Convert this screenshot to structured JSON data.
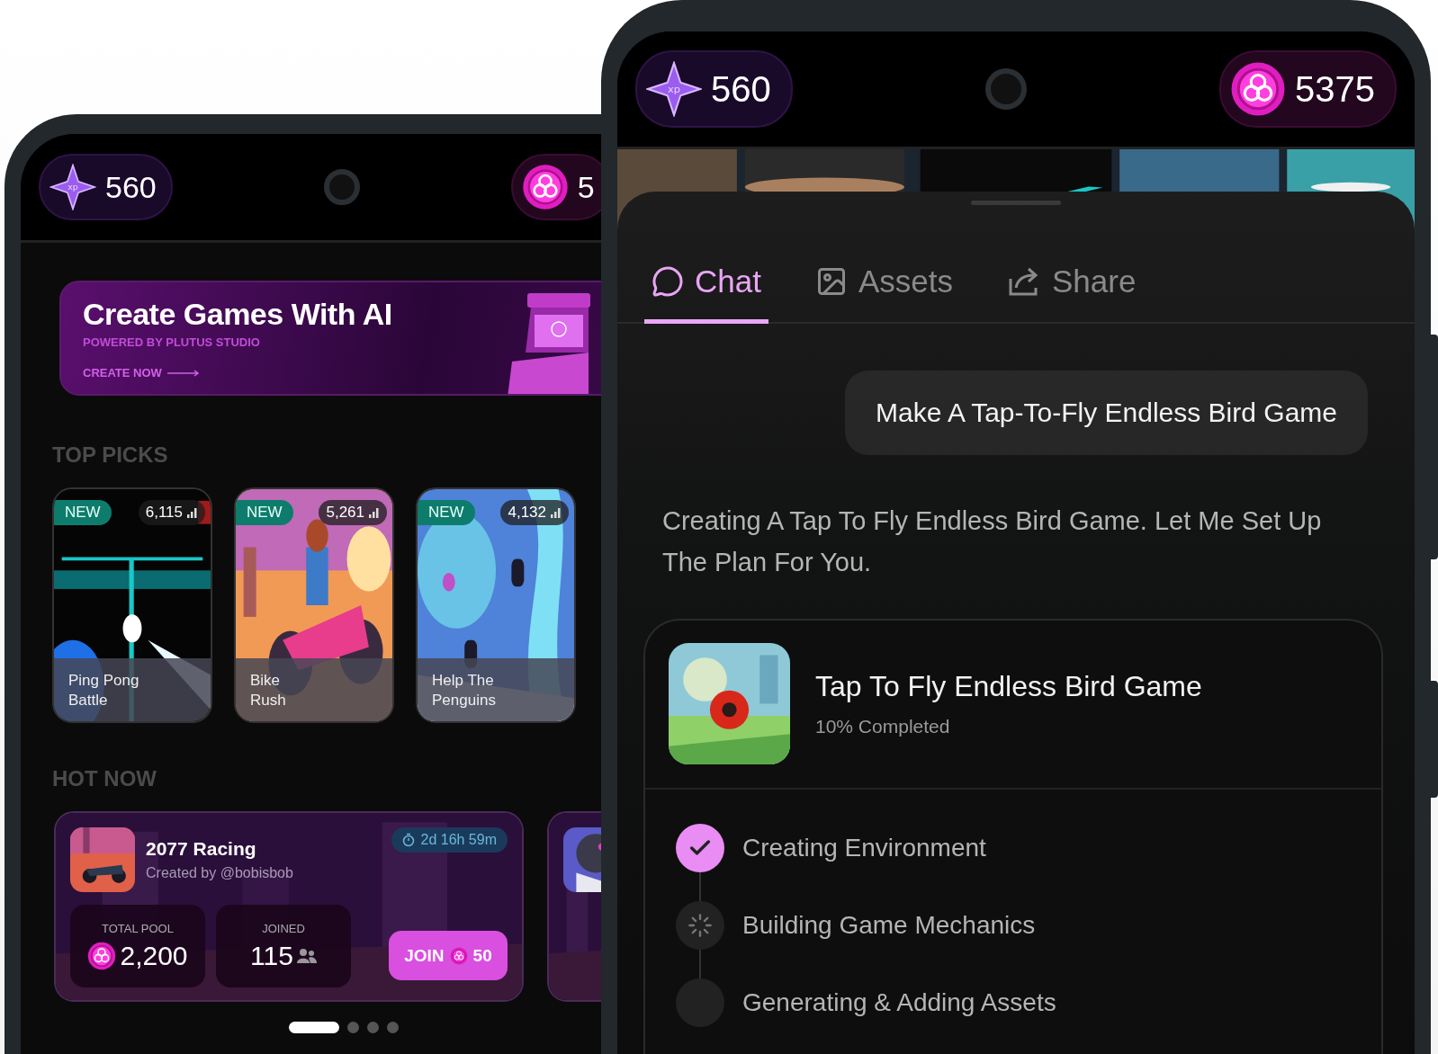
{
  "left_phone": {
    "xp": {
      "icon_label": "xp",
      "value": "560"
    },
    "coins": {
      "value": "5"
    },
    "banner": {
      "title": "Create Games With AI",
      "subtitle": "POWERED BY PLUTUS STUDIO",
      "cta": "CREATE NOW"
    },
    "top_picks": {
      "heading": "TOP PICKS",
      "games": [
        {
          "badge": "NEW",
          "plays": "6,115",
          "title_lines": [
            "Ping Pong",
            "Battle"
          ]
        },
        {
          "badge": "NEW",
          "plays": "5,261",
          "title_lines": [
            "Bike",
            "Rush"
          ]
        },
        {
          "badge": "NEW",
          "plays": "4,132",
          "title_lines": [
            "Help The",
            "Penguins"
          ]
        }
      ]
    },
    "hot_now": {
      "heading": "HOT NOW",
      "card": {
        "title": "2077 Racing",
        "creator": "Created by @bobisbob",
        "timer": "2d 16h 59m",
        "pool_label": "TOTAL POOL",
        "pool": "2,200",
        "joined_label": "JOINED",
        "joined": "115",
        "join_label": "JOIN",
        "join_cost": "50"
      },
      "pager": [
        {
          "selected": true
        },
        {
          "selected": false
        },
        {
          "selected": false
        },
        {
          "selected": false
        }
      ]
    }
  },
  "right_phone": {
    "xp": {
      "icon_label": "xp",
      "value": "560"
    },
    "coins": {
      "value": "5375"
    },
    "tabs": [
      {
        "kind": "chat",
        "label": "Chat",
        "selected": true
      },
      {
        "kind": "assets",
        "label": "Assets",
        "selected": false
      },
      {
        "kind": "share",
        "label": "Share",
        "selected": false
      }
    ],
    "prompt": "Make A Tap-To-Fly Endless Bird Game",
    "reply": "Creating A Tap To Fly Endless Bird Game. Let Me Set Up The Plan For You.",
    "project": {
      "title": "Tap To Fly Endless Bird Game",
      "progress": "10% Completed",
      "steps": [
        {
          "label": "Creating Environment",
          "completed": true,
          "active": false
        },
        {
          "label": "Building Game Mechanics",
          "completed": false,
          "active": true
        },
        {
          "label": "Generating & Adding Assets",
          "completed": false,
          "active": false
        }
      ]
    }
  }
}
